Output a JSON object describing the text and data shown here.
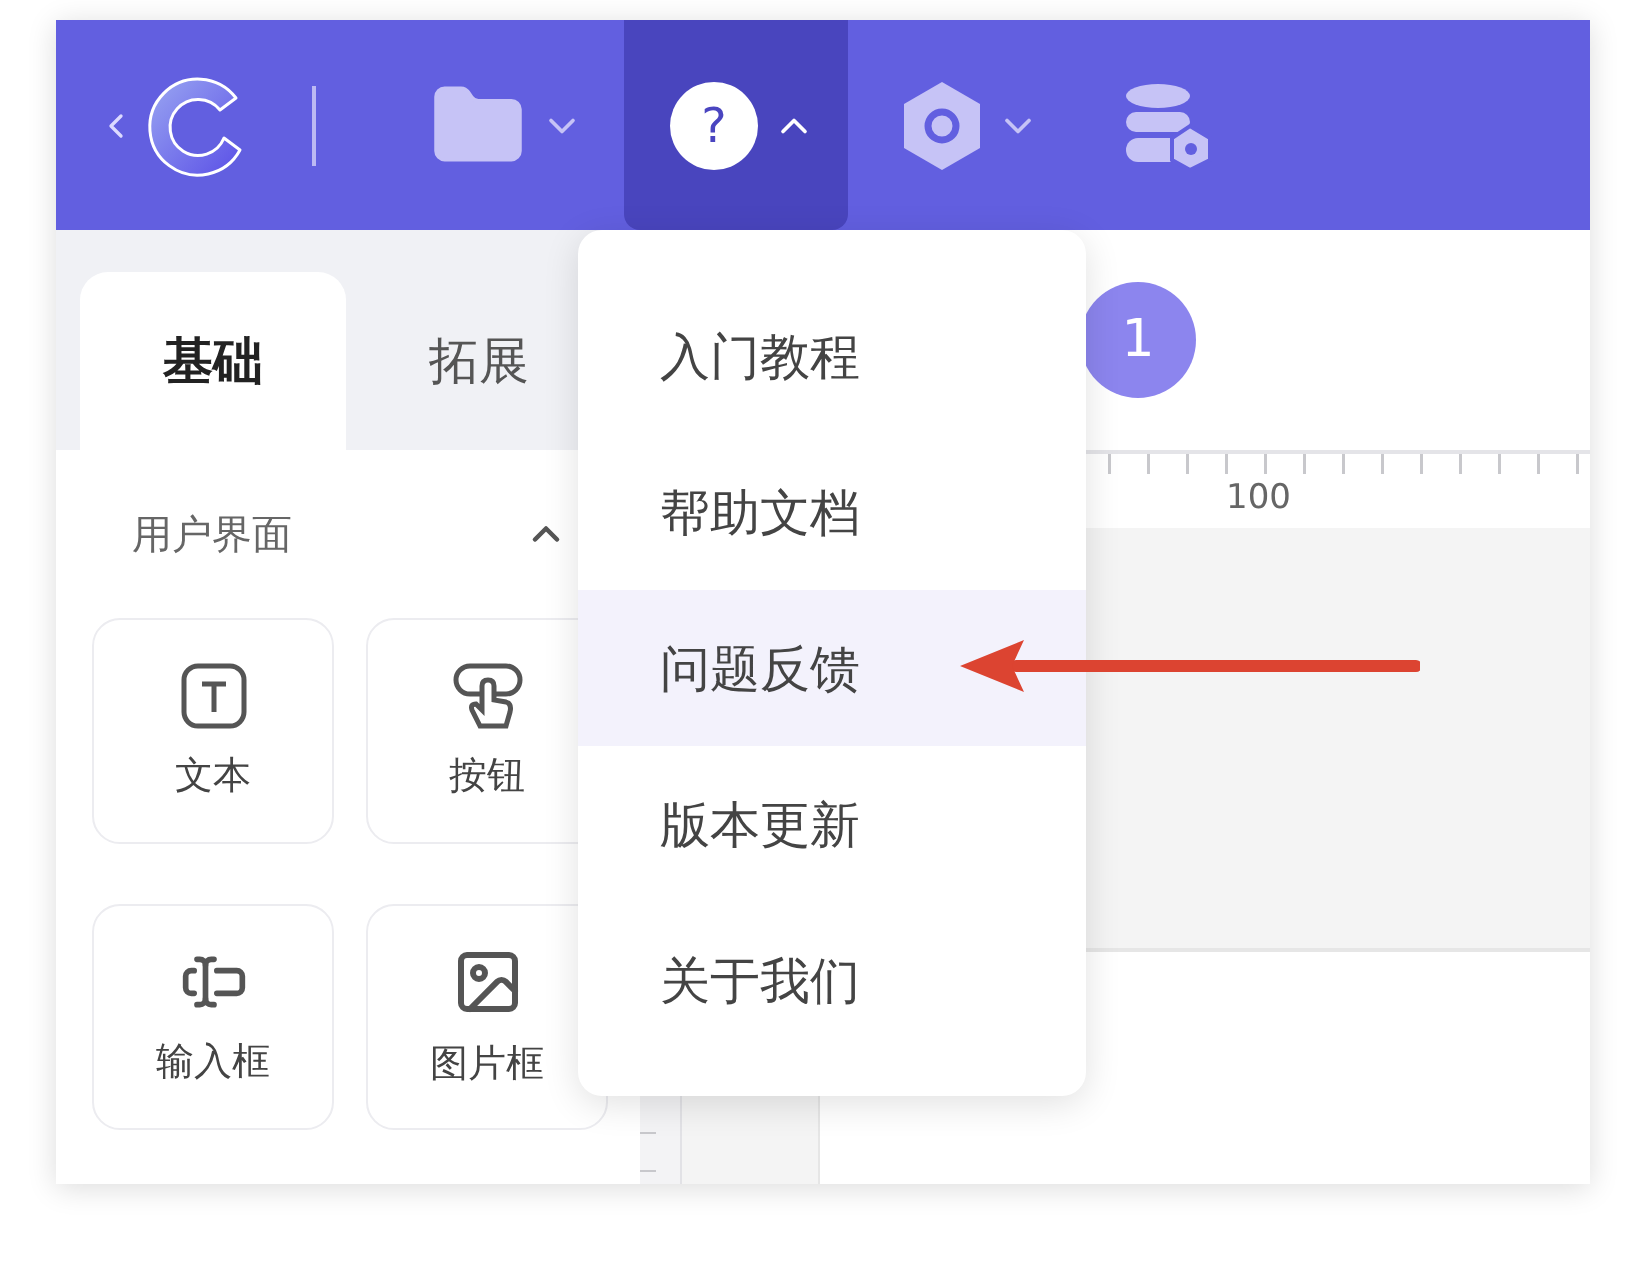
{
  "toolbar": {
    "menus": [
      {
        "kind": "folder",
        "expanded": false
      },
      {
        "kind": "help",
        "glyph": "?",
        "expanded": true
      },
      {
        "kind": "hexagon",
        "expanded": false
      },
      {
        "kind": "database"
      }
    ]
  },
  "sidebar": {
    "tabs": [
      {
        "label": "基础",
        "selected": true
      },
      {
        "label": "拓展",
        "selected": false
      }
    ],
    "section": {
      "title": "用户界面",
      "expanded": true
    },
    "components": [
      {
        "label": "文本",
        "kind": "text"
      },
      {
        "label": "按钮",
        "kind": "button"
      },
      {
        "label": "输入框",
        "kind": "input"
      },
      {
        "label": "图片框",
        "kind": "image"
      }
    ]
  },
  "canvas": {
    "badge": "1",
    "ruler_label": "100"
  },
  "dropdown": {
    "items": [
      {
        "label": "入门教程",
        "selected": false
      },
      {
        "label": "帮助文档",
        "selected": false
      },
      {
        "label": "问题反馈",
        "selected": true
      },
      {
        "label": "版本更新",
        "selected": false
      },
      {
        "label": "关于我们",
        "selected": false
      }
    ]
  }
}
